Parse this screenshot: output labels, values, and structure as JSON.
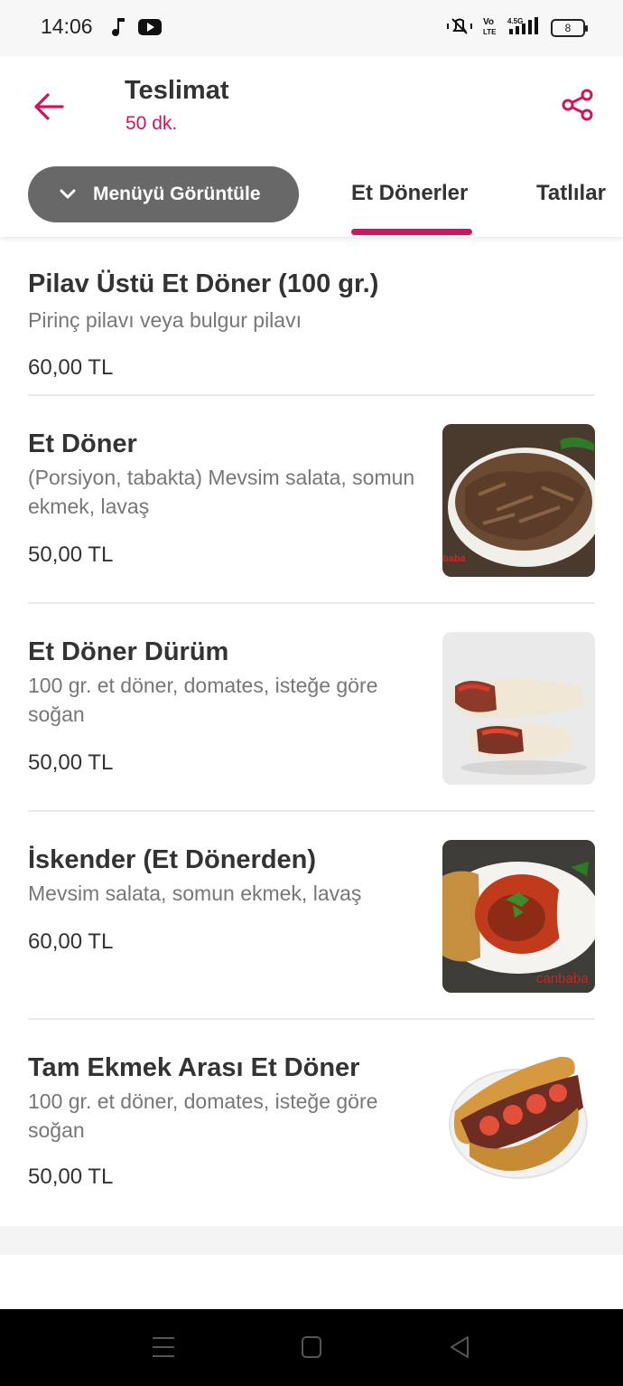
{
  "status_bar": {
    "time": "14:06",
    "left_icons": [
      "music-note-icon",
      "youtube-icon"
    ],
    "right_icons": [
      "mute-vibrate-icon",
      "volte-icon",
      "signal-4-5g-icon"
    ],
    "volte_label": "Vo LTE",
    "network_label": "4.5G",
    "battery_level": "8"
  },
  "header": {
    "back_icon": "arrow-left-icon",
    "title": "Teslimat",
    "subtitle": "50 dk.",
    "share_icon": "share-icon"
  },
  "nav": {
    "menu_button_label": "Menüyü Görüntüle",
    "menu_button_icon": "chevron-down-icon",
    "tabs": [
      {
        "label": "Et Dönerler",
        "active": true
      },
      {
        "label": "Tatlılar",
        "active": false
      }
    ]
  },
  "items": [
    {
      "name": "Pilav Üstü Et Döner (100 gr.)",
      "description": "Pirinç pilavı veya bulgur pilavı",
      "price": "60,00 TL",
      "has_image": false
    },
    {
      "name": "Et Döner",
      "description": "(Porsiyon, tabakta) Mevsim salata, somun ekmek, lavaş",
      "price": "50,00 TL",
      "has_image": true,
      "image_watermark": "baba"
    },
    {
      "name": "Et Döner Dürüm",
      "description": "100 gr. et döner, domates, isteğe göre soğan",
      "price": "50,00 TL",
      "has_image": true
    },
    {
      "name": "İskender (Et Dönerden)",
      "description": "Mevsim salata, somun ekmek, lavaş",
      "price": "60,00 TL",
      "has_image": true,
      "image_watermark": "canbaba"
    },
    {
      "name": "Tam Ekmek Arası Et Döner",
      "description": "100 gr. et döner, domates, isteğe göre soğan",
      "price": "50,00 TL",
      "has_image": true
    }
  ],
  "system_nav": {
    "icons": [
      "menu-lines-icon",
      "home-square-icon",
      "back-triangle-icon"
    ]
  },
  "colors": {
    "accent": "#d0145e",
    "button_bg": "#686868",
    "text": "#333333",
    "muted_text": "#777777",
    "nav_bar": "#000000"
  }
}
